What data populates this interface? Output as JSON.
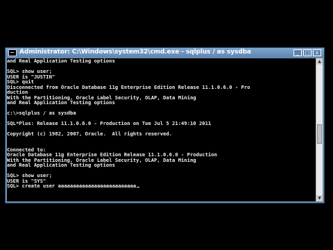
{
  "window": {
    "title": "Administrator: C:\\Windows\\system32\\cmd.exe - sqlplus  / as sysdba",
    "minimize_glyph": "_",
    "maximize_glyph": "□",
    "close_glyph": "x"
  },
  "console": {
    "lines": [
      "and Real Application Testing options",
      "",
      "SQL> show user;",
      "USER is \"JUSTIN\"",
      "SQL> quit",
      "Disconnected from Oracle Database 11g Enterprise Edition Release 11.1.0.6.0 - Pro",
      "duction",
      "With the Partitioning, Oracle Label Security, OLAP, Data Mining",
      "and Real Application Testing options",
      "",
      "c:\\>sqlplus / as sysdba",
      "",
      "SQL*Plus: Release 11.1.0.6.0 - Production on Tue Jul 5 21:49:10 2011",
      "",
      "Copyright (c) 1982, 2007, Oracle.  All rights reserved.",
      "",
      "",
      "Connected to:",
      "Oracle Database 11g Enterprise Edition Release 11.1.0.6.0 - Production",
      "With the Partitioning, Oracle Label Security, OLAP, Data Mining",
      "and Real Application Testing options",
      "",
      "SQL> show user;",
      "USER is \"SYS\"",
      "SQL> create user aaaaaaaaaaaaaaaaaaaaaaaaaa"
    ]
  }
}
